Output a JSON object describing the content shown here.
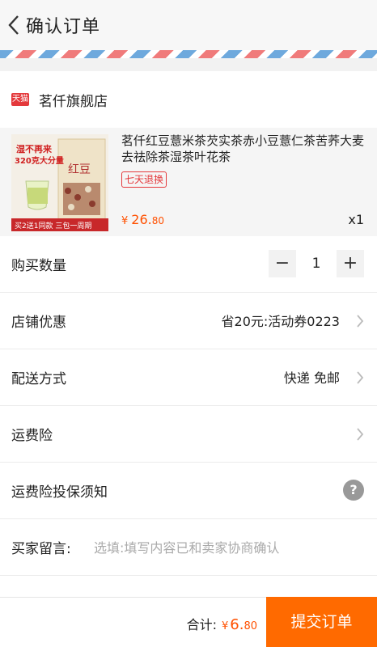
{
  "header": {
    "title": "确认订单",
    "back_icon": "chevron-left-icon"
  },
  "shop": {
    "badge": "天猫",
    "name": "茗仟旗舰店"
  },
  "product": {
    "title": "茗仟红豆薏米茶芡实茶赤小豆薏仁茶苦荞大麦去祛除茶湿茶叶花茶",
    "return_badge": "七天退换",
    "price_symbol": "¥",
    "price_int": "26.",
    "price_dec": "80",
    "quantity_label": "x1",
    "image": {
      "banner_top": "湿不再来",
      "banner_sub": "320克大分量",
      "bottom_strip": "买2送1同款 三包一周期",
      "bag_text": "红豆"
    }
  },
  "quantity": {
    "label": "购买数量",
    "value": "1",
    "minus": "−",
    "plus": "+"
  },
  "store_discount": {
    "label": "店铺优惠",
    "value": "省20元:活动券0223"
  },
  "delivery": {
    "label": "配送方式",
    "value": "快递 免邮"
  },
  "freight_insurance": {
    "label": "运费险"
  },
  "insurance_notice": {
    "label": "运费险投保须知",
    "help": "?"
  },
  "remark": {
    "label": "买家留言:",
    "placeholder": "选填:填写内容已和卖家协商确认"
  },
  "footer": {
    "total_label": "合计:",
    "total_symbol": "¥",
    "total_int": "6.",
    "total_dec": "80",
    "submit_label": "提交订单"
  },
  "colors": {
    "accent": "#ff5000",
    "submit": "#ff6a00",
    "tmall": "#e4393c"
  }
}
